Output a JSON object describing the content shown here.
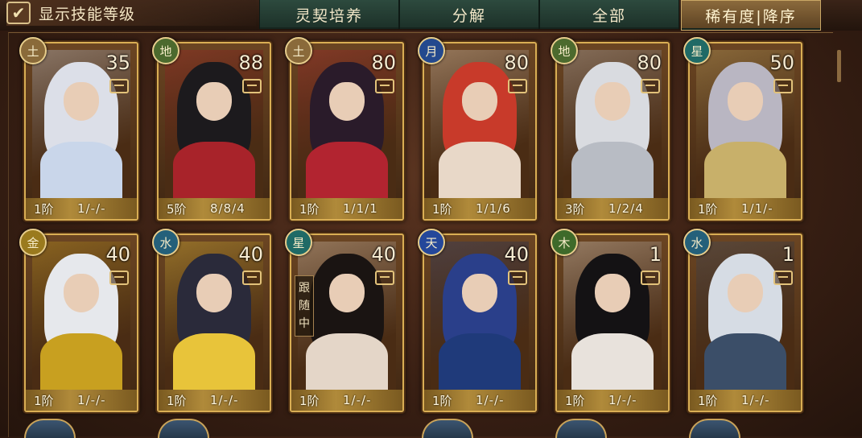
{
  "toolbar": {
    "show_skill_level_label": "显示技能等级",
    "show_skill_level_checked": true,
    "tabs": [
      "灵契培养",
      "分解",
      "全部"
    ],
    "sort_label": "稀有度|降序"
  },
  "cards": [
    {
      "element": "土",
      "element_color": "#8a6a3a",
      "level": "35",
      "grade": "1阶",
      "skills": "1/-/-",
      "palette": [
        "#dcdfe8",
        "#c9d6ea"
      ]
    },
    {
      "element": "地",
      "element_color": "#4c6a2e",
      "level": "88",
      "grade": "5阶",
      "skills": "8/8/4",
      "palette": [
        "#1c1a1d",
        "#a8232a"
      ]
    },
    {
      "element": "土",
      "element_color": "#8a6a3a",
      "level": "80",
      "grade": "1阶",
      "skills": "1/1/1",
      "palette": [
        "#2a1b2a",
        "#b22430"
      ]
    },
    {
      "element": "月",
      "element_color": "#23498e",
      "level": "80",
      "grade": "1阶",
      "skills": "1/1/6",
      "palette": [
        "#c83a2a",
        "#e8d8c8"
      ]
    },
    {
      "element": "地",
      "element_color": "#4c6a2e",
      "level": "80",
      "grade": "3阶",
      "skills": "1/2/4",
      "palette": [
        "#d9dbe0",
        "#b8bcc4"
      ]
    },
    {
      "element": "星",
      "element_color": "#1f6a66",
      "level": "50",
      "grade": "1阶",
      "skills": "1/1/-",
      "palette": [
        "#b9b6c2",
        "#c8b06a"
      ]
    },
    {
      "element": "金",
      "element_color": "#9a7a1e",
      "level": "40",
      "grade": "1阶",
      "skills": "1/-/-",
      "palette": [
        "#e6e8ec",
        "#c8a020"
      ]
    },
    {
      "element": "水",
      "element_color": "#24607a",
      "level": "40",
      "grade": "1阶",
      "skills": "1/-/-",
      "palette": [
        "#2a2a3a",
        "#e8c43a"
      ]
    },
    {
      "element": "星",
      "element_color": "#1f6a66",
      "level": "40",
      "grade": "1阶",
      "skills": "1/-/-",
      "palette": [
        "#1a1412",
        "#e4d6c8"
      ],
      "follow": "跟随中"
    },
    {
      "element": "天",
      "element_color": "#24479a",
      "level": "40",
      "grade": "1阶",
      "skills": "1/-/-",
      "palette": [
        "#2a3f8a",
        "#1f3a7a"
      ]
    },
    {
      "element": "木",
      "element_color": "#3e6a2a",
      "level": "1",
      "grade": "1阶",
      "skills": "1/-/-",
      "palette": [
        "#141214",
        "#e8e2dc"
      ]
    },
    {
      "element": "水",
      "element_color": "#24607a",
      "level": "1",
      "grade": "1阶",
      "skills": "1/-/-",
      "palette": [
        "#d6dce4",
        "#3b4e68"
      ]
    }
  ]
}
